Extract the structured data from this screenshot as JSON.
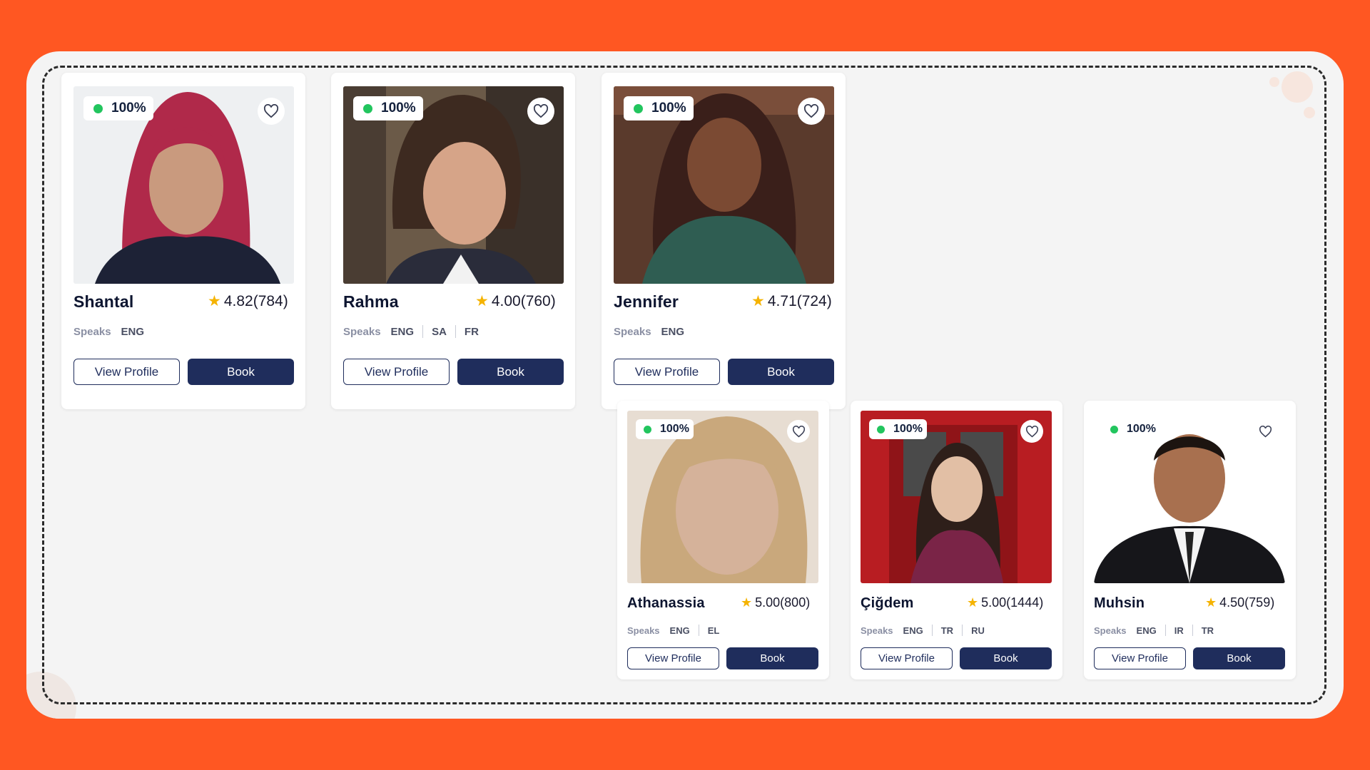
{
  "colors": {
    "background": "#ff5722",
    "panel": "#f4f4f4",
    "online_dot": "#22c55e",
    "book_button": "#1f2d5c",
    "star": "#f5b301"
  },
  "icons": {
    "favorite": "heart-outline-icon",
    "rating": "star-icon",
    "status": "online-dot-icon"
  },
  "tutors": [
    {
      "status": "100%",
      "name": "Shantal",
      "rating": "4.82(784)",
      "speaks_label": "Speaks",
      "languages": [
        "ENG"
      ],
      "view_label": "View Profile",
      "book_label": "Book"
    },
    {
      "status": "100%",
      "name": "Rahma",
      "rating": "4.00(760)",
      "speaks_label": "Speaks",
      "languages": [
        "ENG",
        "SA",
        "FR"
      ],
      "view_label": "View Profile",
      "book_label": "Book"
    },
    {
      "status": "100%",
      "name": "Jennifer",
      "rating": "4.71(724)",
      "speaks_label": "Speaks",
      "languages": [
        "ENG"
      ],
      "view_label": "View Profile",
      "book_label": "Book"
    },
    {
      "status": "100%",
      "name": "Athanassia",
      "rating": "5.00(800)",
      "speaks_label": "Speaks",
      "languages": [
        "ENG",
        "EL"
      ],
      "view_label": "View Profile",
      "book_label": "Book"
    },
    {
      "status": "100%",
      "name": "Çiğdem",
      "rating": "5.00(1444)",
      "speaks_label": "Speaks",
      "languages": [
        "ENG",
        "TR",
        "RU"
      ],
      "view_label": "View Profile",
      "book_label": "Book"
    },
    {
      "status": "100%",
      "name": "Muhsin",
      "rating": "4.50(759)",
      "speaks_label": "Speaks",
      "languages": [
        "ENG",
        "IR",
        "TR"
      ],
      "view_label": "View Profile",
      "book_label": "Book"
    }
  ]
}
